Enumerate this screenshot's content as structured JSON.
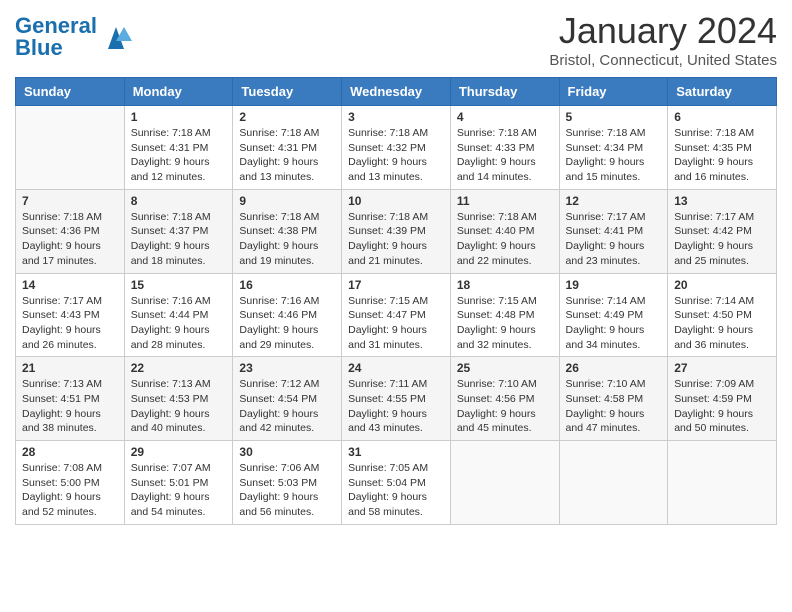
{
  "header": {
    "logo_general": "General",
    "logo_blue": "Blue",
    "title": "January 2024",
    "subtitle": "Bristol, Connecticut, United States"
  },
  "days_of_week": [
    "Sunday",
    "Monday",
    "Tuesday",
    "Wednesday",
    "Thursday",
    "Friday",
    "Saturday"
  ],
  "weeks": [
    [
      {
        "day": "",
        "info": ""
      },
      {
        "day": "1",
        "info": "Sunrise: 7:18 AM\nSunset: 4:31 PM\nDaylight: 9 hours\nand 12 minutes."
      },
      {
        "day": "2",
        "info": "Sunrise: 7:18 AM\nSunset: 4:31 PM\nDaylight: 9 hours\nand 13 minutes."
      },
      {
        "day": "3",
        "info": "Sunrise: 7:18 AM\nSunset: 4:32 PM\nDaylight: 9 hours\nand 13 minutes."
      },
      {
        "day": "4",
        "info": "Sunrise: 7:18 AM\nSunset: 4:33 PM\nDaylight: 9 hours\nand 14 minutes."
      },
      {
        "day": "5",
        "info": "Sunrise: 7:18 AM\nSunset: 4:34 PM\nDaylight: 9 hours\nand 15 minutes."
      },
      {
        "day": "6",
        "info": "Sunrise: 7:18 AM\nSunset: 4:35 PM\nDaylight: 9 hours\nand 16 minutes."
      }
    ],
    [
      {
        "day": "7",
        "info": "Sunrise: 7:18 AM\nSunset: 4:36 PM\nDaylight: 9 hours\nand 17 minutes."
      },
      {
        "day": "8",
        "info": "Sunrise: 7:18 AM\nSunset: 4:37 PM\nDaylight: 9 hours\nand 18 minutes."
      },
      {
        "day": "9",
        "info": "Sunrise: 7:18 AM\nSunset: 4:38 PM\nDaylight: 9 hours\nand 19 minutes."
      },
      {
        "day": "10",
        "info": "Sunrise: 7:18 AM\nSunset: 4:39 PM\nDaylight: 9 hours\nand 21 minutes."
      },
      {
        "day": "11",
        "info": "Sunrise: 7:18 AM\nSunset: 4:40 PM\nDaylight: 9 hours\nand 22 minutes."
      },
      {
        "day": "12",
        "info": "Sunrise: 7:17 AM\nSunset: 4:41 PM\nDaylight: 9 hours\nand 23 minutes."
      },
      {
        "day": "13",
        "info": "Sunrise: 7:17 AM\nSunset: 4:42 PM\nDaylight: 9 hours\nand 25 minutes."
      }
    ],
    [
      {
        "day": "14",
        "info": "Sunrise: 7:17 AM\nSunset: 4:43 PM\nDaylight: 9 hours\nand 26 minutes."
      },
      {
        "day": "15",
        "info": "Sunrise: 7:16 AM\nSunset: 4:44 PM\nDaylight: 9 hours\nand 28 minutes."
      },
      {
        "day": "16",
        "info": "Sunrise: 7:16 AM\nSunset: 4:46 PM\nDaylight: 9 hours\nand 29 minutes."
      },
      {
        "day": "17",
        "info": "Sunrise: 7:15 AM\nSunset: 4:47 PM\nDaylight: 9 hours\nand 31 minutes."
      },
      {
        "day": "18",
        "info": "Sunrise: 7:15 AM\nSunset: 4:48 PM\nDaylight: 9 hours\nand 32 minutes."
      },
      {
        "day": "19",
        "info": "Sunrise: 7:14 AM\nSunset: 4:49 PM\nDaylight: 9 hours\nand 34 minutes."
      },
      {
        "day": "20",
        "info": "Sunrise: 7:14 AM\nSunset: 4:50 PM\nDaylight: 9 hours\nand 36 minutes."
      }
    ],
    [
      {
        "day": "21",
        "info": "Sunrise: 7:13 AM\nSunset: 4:51 PM\nDaylight: 9 hours\nand 38 minutes."
      },
      {
        "day": "22",
        "info": "Sunrise: 7:13 AM\nSunset: 4:53 PM\nDaylight: 9 hours\nand 40 minutes."
      },
      {
        "day": "23",
        "info": "Sunrise: 7:12 AM\nSunset: 4:54 PM\nDaylight: 9 hours\nand 42 minutes."
      },
      {
        "day": "24",
        "info": "Sunrise: 7:11 AM\nSunset: 4:55 PM\nDaylight: 9 hours\nand 43 minutes."
      },
      {
        "day": "25",
        "info": "Sunrise: 7:10 AM\nSunset: 4:56 PM\nDaylight: 9 hours\nand 45 minutes."
      },
      {
        "day": "26",
        "info": "Sunrise: 7:10 AM\nSunset: 4:58 PM\nDaylight: 9 hours\nand 47 minutes."
      },
      {
        "day": "27",
        "info": "Sunrise: 7:09 AM\nSunset: 4:59 PM\nDaylight: 9 hours\nand 50 minutes."
      }
    ],
    [
      {
        "day": "28",
        "info": "Sunrise: 7:08 AM\nSunset: 5:00 PM\nDaylight: 9 hours\nand 52 minutes."
      },
      {
        "day": "29",
        "info": "Sunrise: 7:07 AM\nSunset: 5:01 PM\nDaylight: 9 hours\nand 54 minutes."
      },
      {
        "day": "30",
        "info": "Sunrise: 7:06 AM\nSunset: 5:03 PM\nDaylight: 9 hours\nand 56 minutes."
      },
      {
        "day": "31",
        "info": "Sunrise: 7:05 AM\nSunset: 5:04 PM\nDaylight: 9 hours\nand 58 minutes."
      },
      {
        "day": "",
        "info": ""
      },
      {
        "day": "",
        "info": ""
      },
      {
        "day": "",
        "info": ""
      }
    ]
  ]
}
